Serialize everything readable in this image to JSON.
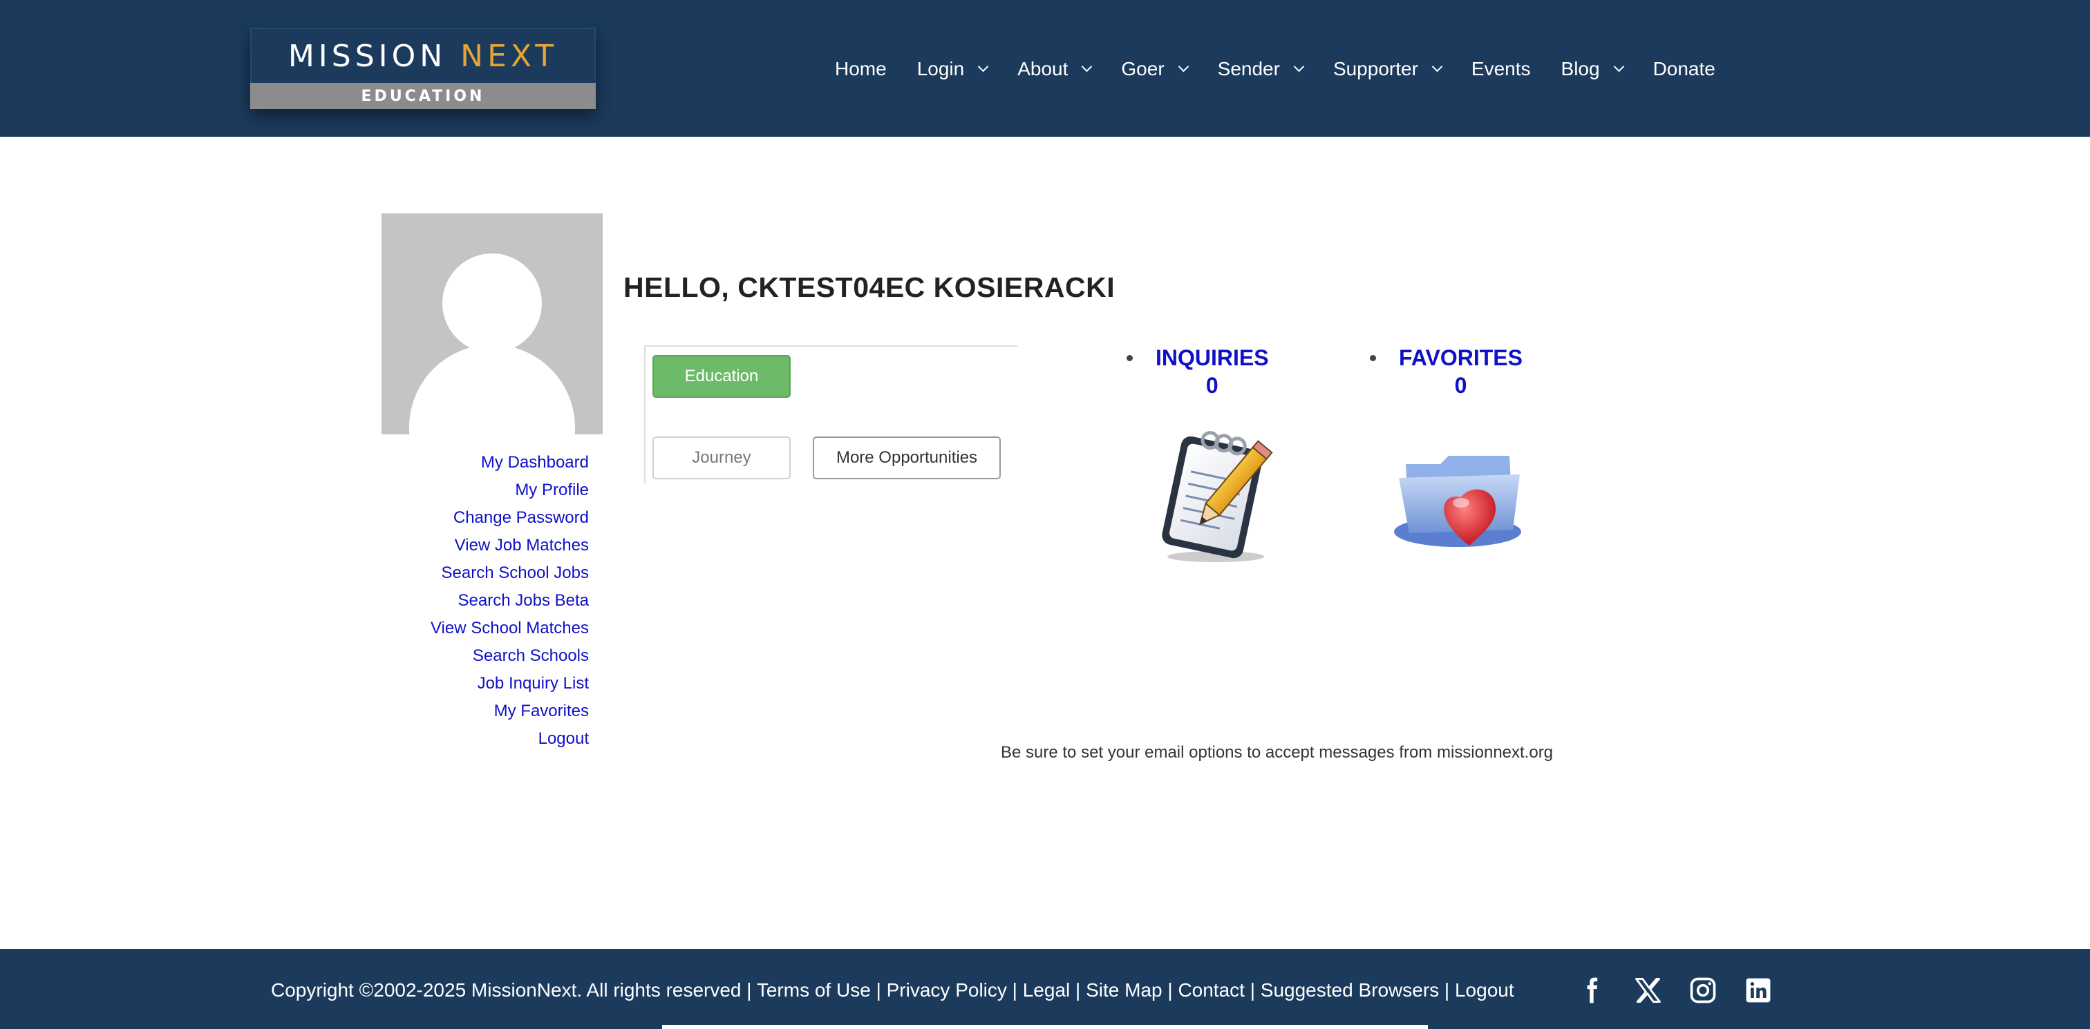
{
  "header": {
    "logo": {
      "word1": "MISSION",
      "word2": "NEXT",
      "subtitle": "EDUCATION"
    },
    "nav": [
      {
        "label": "Home",
        "dropdown": false
      },
      {
        "label": "Login",
        "dropdown": true
      },
      {
        "label": "About",
        "dropdown": true
      },
      {
        "label": "Goer",
        "dropdown": true
      },
      {
        "label": "Sender",
        "dropdown": true
      },
      {
        "label": "Supporter",
        "dropdown": true
      },
      {
        "label": "Events",
        "dropdown": false
      },
      {
        "label": "Blog",
        "dropdown": true
      },
      {
        "label": "Donate",
        "dropdown": false
      }
    ]
  },
  "sidebar": {
    "links": [
      "My Dashboard",
      "My Profile",
      "Change Password",
      "View Job Matches",
      "Search School Jobs",
      "Search Jobs Beta",
      "View School Matches",
      "Search Schools",
      "Job Inquiry List",
      "My Favorites",
      "Logout"
    ]
  },
  "main": {
    "greeting": "HELLO, CKTEST04EC KOSIERACKI",
    "buttons": {
      "education": "Education",
      "journey": "Journey",
      "more": "More Opportunities"
    },
    "inquiries": {
      "label": "INQUIRIES",
      "count": "0"
    },
    "favorites": {
      "label": "FAVORITES",
      "count": "0"
    },
    "notice": "Be sure to set your email options to accept messages from missionnext.org"
  },
  "footer": {
    "copyright": "Copyright ©2002-2025 MissionNext. All rights reserved",
    "links": [
      "Terms of Use",
      "Privacy Policy",
      "Legal",
      "Site Map",
      "Contact",
      "Suggested Browsers",
      "Logout"
    ],
    "social": [
      "facebook-icon",
      "x-icon",
      "instagram-icon",
      "linkedin-icon"
    ]
  },
  "colors": {
    "navy": "#1b3a5c",
    "accent": "#e6a532",
    "link": "#1010c8",
    "green": "#6dba69"
  }
}
